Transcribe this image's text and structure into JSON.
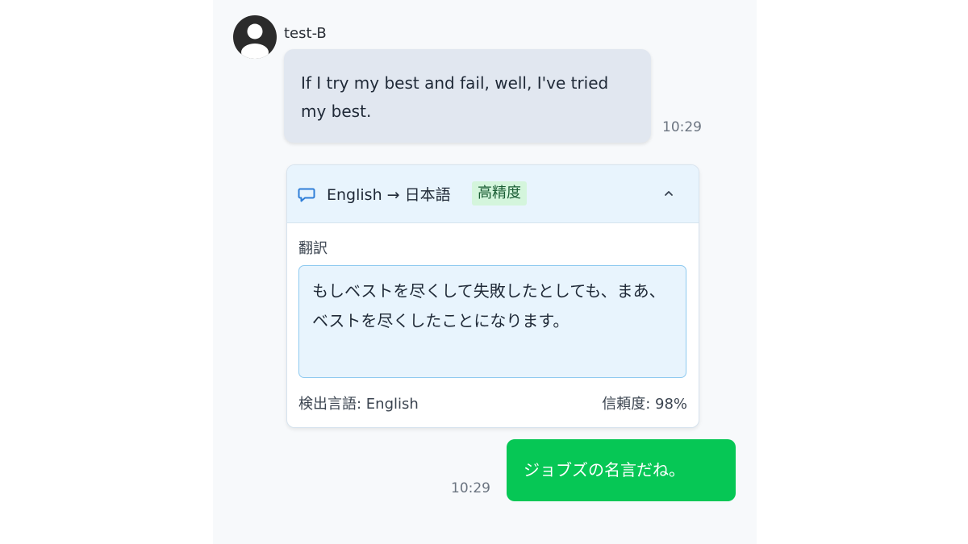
{
  "incoming_message": {
    "sender": "test-B",
    "text": "If I try my best and fail, well, I've tried my best.",
    "time": "10:29",
    "avatar_icon": "user-icon"
  },
  "translation": {
    "icon": "chat-bubble-icon",
    "language_pair": "English → 日本語",
    "quality_badge": "高精度",
    "collapse_icon": "chevron-up-icon",
    "section_label": "翻訳",
    "translated_text": "もしベストを尽くして失敗したとしても、まあ、ベストを尽くしたことになります。",
    "detected_language": "検出言語: English",
    "confidence": "信頼度: 98%"
  },
  "outgoing_message": {
    "text": "ジョブズの名言だね。",
    "time": "10:29"
  },
  "colors": {
    "panel_bg": "#f7f9fb",
    "incoming_bubble": "#e1e7f0",
    "outgoing_bubble": "#06c755",
    "translation_header": "#e8f4fd",
    "badge_bg": "#d4f5dc",
    "accent_blue": "#2f7ed8"
  }
}
